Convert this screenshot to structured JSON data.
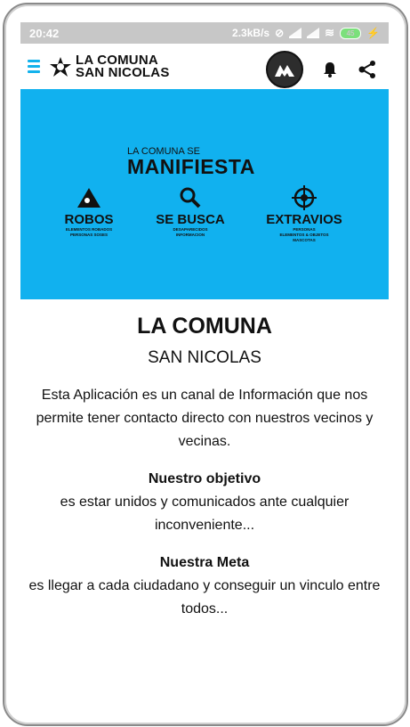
{
  "status": {
    "time": "20:42",
    "speed": "2.3kB/s",
    "battery": "45"
  },
  "appbar": {
    "brand_line1": "LA COMUNA",
    "brand_line2": "SAN NICOLAS"
  },
  "banner": {
    "kicker": "LA COMUNA SE",
    "title": "MANIFIESTA",
    "background": "#11b1ef",
    "categories": [
      {
        "label": "ROBOS",
        "sub1": "ELEMENTOS ROBADOS",
        "sub2": "PERSONAS SOSES"
      },
      {
        "label": "SE BUSCA",
        "sub1": "DESAPARECIDOS",
        "sub2": "INFORMACION"
      },
      {
        "label": "EXTRAVIOS",
        "sub1": "PERSONAS",
        "sub2": "ELEMENTOS & OBJETOS",
        "sub3": "MASCOTAS"
      }
    ]
  },
  "main": {
    "title": "LA COMUNA",
    "subtitle": "SAN NICOLAS",
    "intro": "Esta Aplicación es un canal de Información que nos permite tener contacto directo con nuestros vecinos y vecinas.",
    "objective_heading": "Nuestro objetivo",
    "objective_text": "es estar unidos y comunicados ante cualquier inconveniente...",
    "goal_heading": "Nuestra Meta",
    "goal_text": "es llegar a cada ciudadano y conseguir un vinculo entre todos..."
  },
  "colors": {
    "accent": "#13b2ec",
    "status_bar": "#c7c7c7"
  }
}
